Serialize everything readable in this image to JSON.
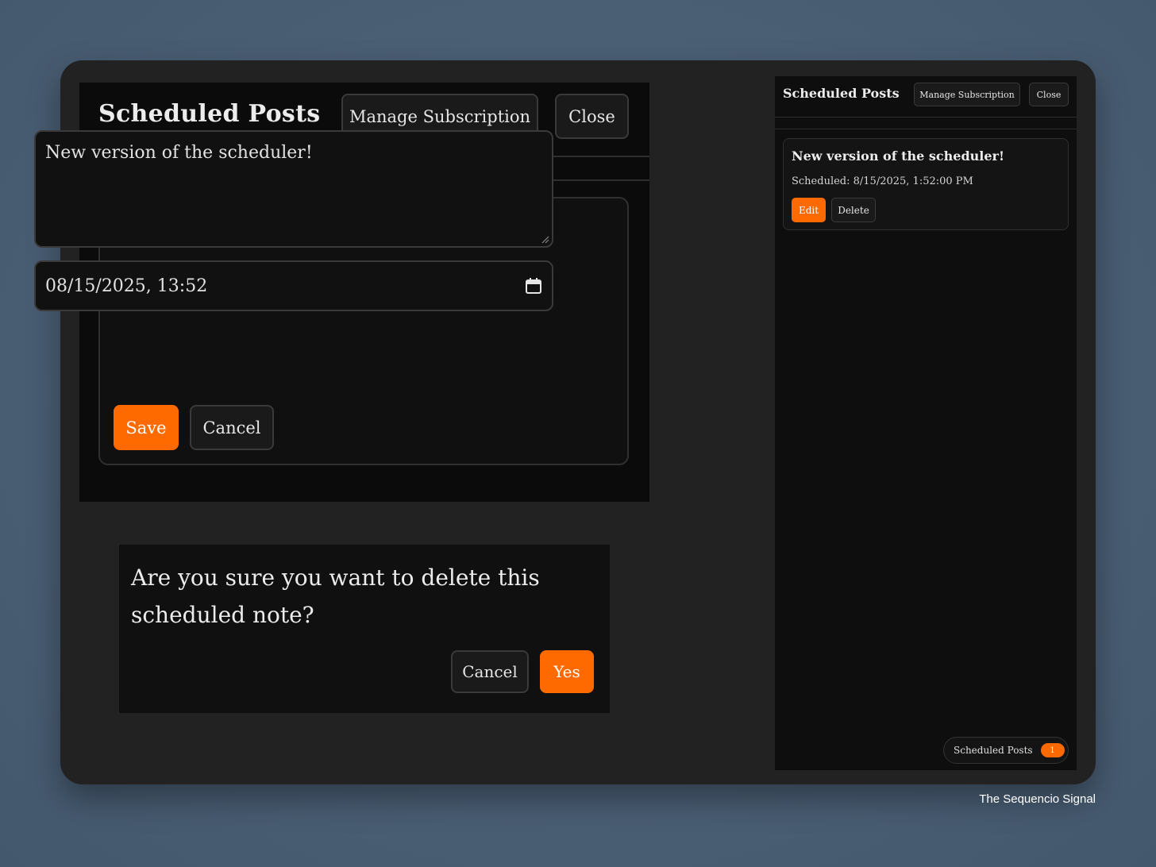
{
  "editor": {
    "title": "Scheduled Posts",
    "manage_label": "Manage Subscription",
    "close_label": "Close",
    "note_text": "New version of the scheduler!",
    "datetime_value": "08/15/2025, 13:52",
    "save_label": "Save",
    "cancel_label": "Cancel"
  },
  "dialog": {
    "message": "Are you sure you want to delete this scheduled note?",
    "cancel_label": "Cancel",
    "yes_label": "Yes"
  },
  "side": {
    "title": "Scheduled Posts",
    "manage_label": "Manage Subscription",
    "close_label": "Close",
    "post": {
      "title": "New version of the scheduler!",
      "scheduled": "Scheduled: 8/15/2025, 1:52:00 PM",
      "edit_label": "Edit",
      "delete_label": "Delete"
    },
    "pill": {
      "label": "Scheduled Posts",
      "count": "1"
    }
  },
  "watermark": "The Sequencio Signal",
  "colors": {
    "accent": "#ff6a00",
    "panel": "#0b0b0b",
    "frame": "#222222",
    "backdrop": "#4a5e74"
  },
  "icons": {
    "calendar": "calendar-icon",
    "resize": "resize-handle-icon"
  }
}
